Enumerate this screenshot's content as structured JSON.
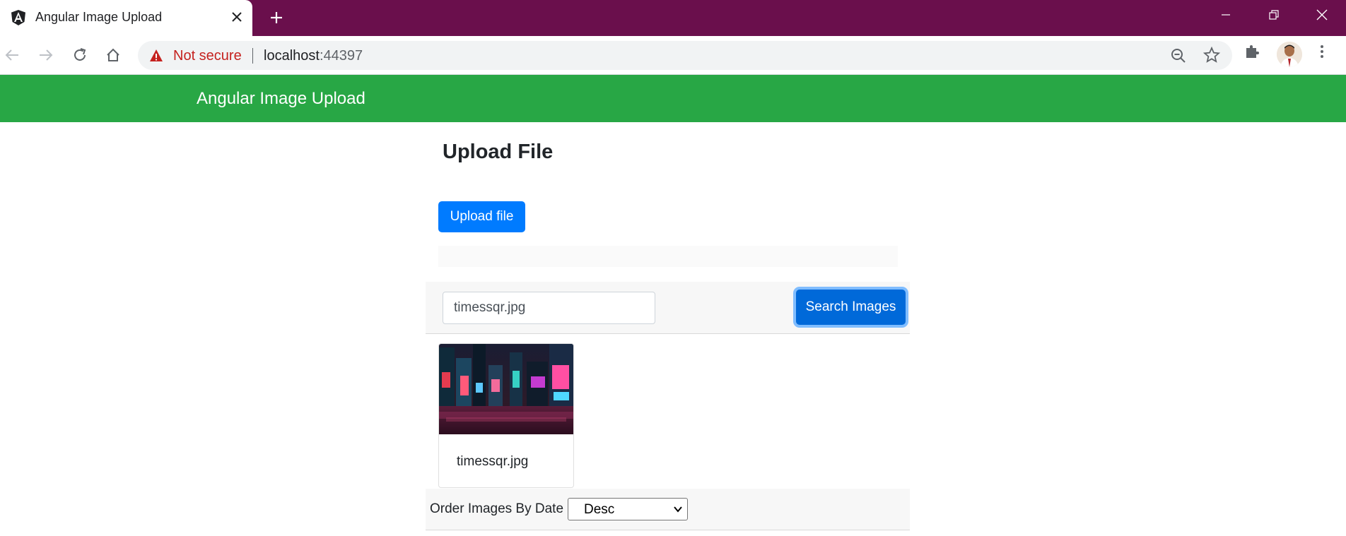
{
  "browser": {
    "tab_title": "Angular Image Upload",
    "security_label": "Not secure",
    "url_host": "localhost",
    "url_port": ":44397"
  },
  "navbar": {
    "brand": "Angular Image Upload",
    "color": "#28a745"
  },
  "upload": {
    "title": "Upload File",
    "button_label": "Upload file"
  },
  "search": {
    "input_value": "timessqr.jpg",
    "button_label": "Search Images"
  },
  "results": [
    {
      "caption": "timessqr.jpg"
    }
  ],
  "order": {
    "label": "Order Images By Date :",
    "selected": "Desc"
  },
  "colors": {
    "tabstrip": "#6a0f4c",
    "primary": "#007bff",
    "warning": "#c5221f"
  }
}
